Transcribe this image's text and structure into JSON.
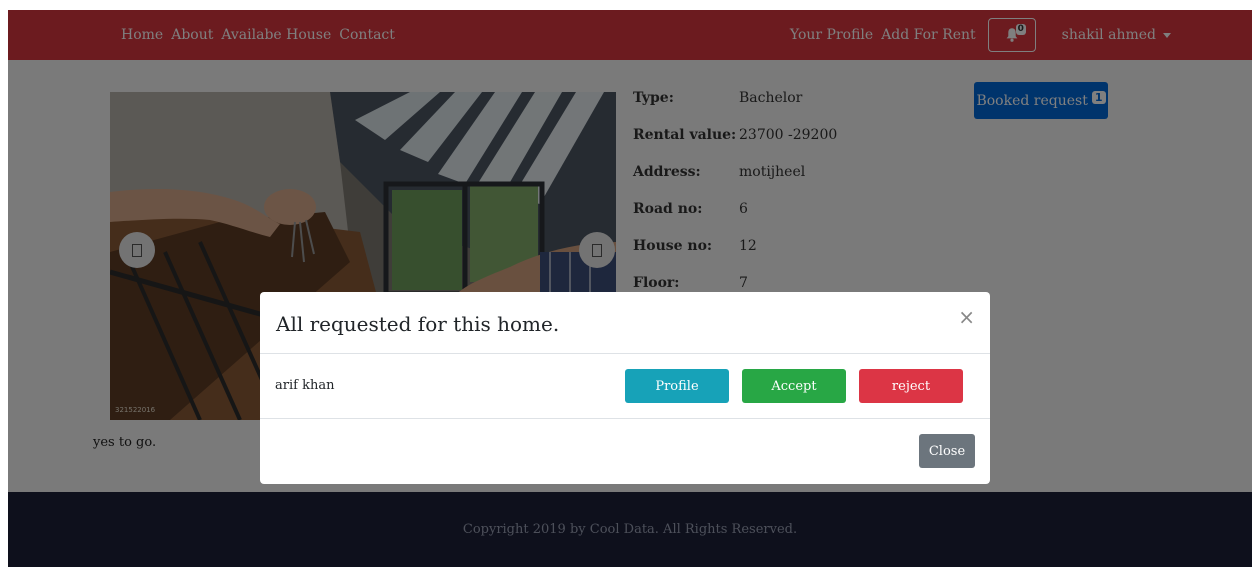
{
  "nav": {
    "left_links": [
      "Home",
      "About",
      "Availabe House",
      "Contact"
    ],
    "profile_link": "Your Profile",
    "add_rent_link": "Add For Rent",
    "notification_count": "0",
    "user_name": "shakil ahmed"
  },
  "listing": {
    "details": [
      {
        "label": "Type:",
        "value": "Bachelor"
      },
      {
        "label": "Rental value:",
        "value": "23700 -29200"
      },
      {
        "label": "Address:",
        "value": "motijheel"
      },
      {
        "label": "Road no:",
        "value": "6"
      },
      {
        "label": "House no:",
        "value": "12"
      },
      {
        "label": "Floor:",
        "value": "7"
      }
    ],
    "description": "yes to go.",
    "image_watermark": "321522016"
  },
  "booked_request": {
    "label": "Booked request",
    "count": "1"
  },
  "modal": {
    "title": "All requested for this home.",
    "close_symbol": "×",
    "requester_name": "arif khan",
    "profile_label": "Profile",
    "accept_label": "Accept",
    "reject_label": "reject",
    "close_label": "Close"
  },
  "footer": {
    "text": "Copyright 2019 by Cool Data. All Rights Reserved."
  },
  "colors": {
    "navbar": "#d9363e",
    "primary": "#0069d9",
    "info": "#17a2b8",
    "success": "#28a745",
    "danger": "#dc3545",
    "secondary": "#6c757d",
    "footer": "#1c2038"
  }
}
